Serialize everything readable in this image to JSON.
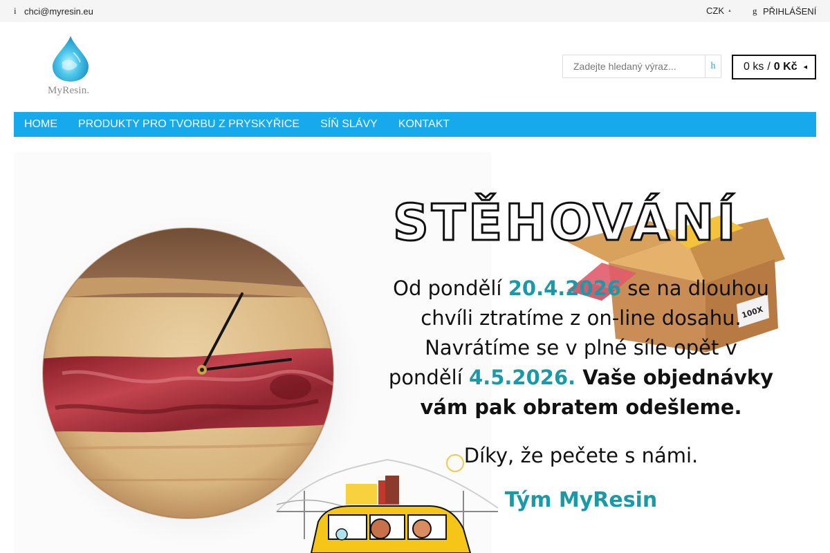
{
  "topbar": {
    "email_icon": "i",
    "email": "chci@myresin.eu",
    "currency": "CZK",
    "login_icon": "g",
    "login": "PŘIHLÁŠENÍ"
  },
  "logo": {
    "brand": "MyResin."
  },
  "search": {
    "placeholder": "Zadejte hledaný výraz...",
    "button_icon": "h"
  },
  "cart": {
    "count": "0 ks",
    "separator": "/",
    "total": "0 Kč"
  },
  "nav": {
    "items": [
      {
        "label": "HOME"
      },
      {
        "label": "PRODUKTY PRO TVORBU Z PRYSKYŘICE"
      },
      {
        "label": "SÍŇ SLÁVY"
      },
      {
        "label": "KONTAKT"
      }
    ]
  },
  "banner": {
    "title": "STĚHOVÁNÍ",
    "line1_a": "Od pondělí ",
    "date_from": "20.4.2026",
    "line1_b": " se na dlouhou chvíli ztratíme z on-line dosahu. Navrátíme se v plné síle opět v pondělí ",
    "date_to": "4.5.2026.",
    "line_bold": " Vaše objednávky vám pak obratem odešleme.",
    "thanks": "Díky, že pečete s námi.",
    "team": "Tým MyResin",
    "box_label": "100X",
    "colors": {
      "accent": "#1a9aa8",
      "nav": "#16a9eb",
      "resin": "#a8303a",
      "wood": "#d9b783"
    }
  }
}
